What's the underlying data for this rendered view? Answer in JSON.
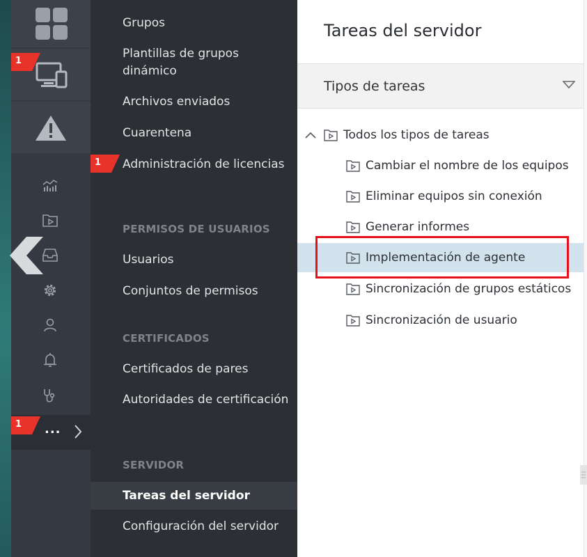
{
  "rail": {
    "badge_devices": "1",
    "badge_more": "1",
    "more_label": "..."
  },
  "nav": {
    "items_top": [
      "Grupos",
      "Plantillas de grupos dinámico",
      "Archivos enviados",
      "Cuarentena",
      "Administración de licencias"
    ],
    "license_badge": "1",
    "section_permissions": "PERMISOS DE USUARIOS",
    "permissions_items": [
      "Usuarios",
      "Conjuntos de permisos"
    ],
    "section_certificates": "CERTIFICADOS",
    "certificates_items": [
      "Certificados de pares",
      "Autoridades de certificación"
    ],
    "section_server": "SERVIDOR",
    "server_items": [
      "Tareas del servidor",
      "Configuración del servidor"
    ]
  },
  "content": {
    "title": "Tareas del servidor",
    "task_types_label": "Tipos de tareas",
    "tree_root": "Todos los tipos de tareas",
    "tree_children": [
      "Cambiar el nombre de los equipos",
      "Eliminar equipos sin conexión",
      "Generar informes",
      "Implementación de agente",
      "Sincronización de grupos estáticos",
      "Sincronización de usuario"
    ],
    "selected_index": 3
  },
  "colors": {
    "rail_bg": "#353a42",
    "nav_bg": "#2c2f34",
    "badge_red": "#e8332a",
    "highlight_red": "#e81018",
    "selected_row": "#d3e3ee"
  },
  "icons": [
    "dashboard-icon",
    "devices-icon",
    "alert-icon",
    "chart-icon",
    "play-folder-icon",
    "inbox-icon",
    "gear-icon",
    "user-icon",
    "bell-icon",
    "stethoscope-icon",
    "chevron-right-icon",
    "back-arrow-icon",
    "chevron-up-icon",
    "dropdown-triangle-icon"
  ]
}
